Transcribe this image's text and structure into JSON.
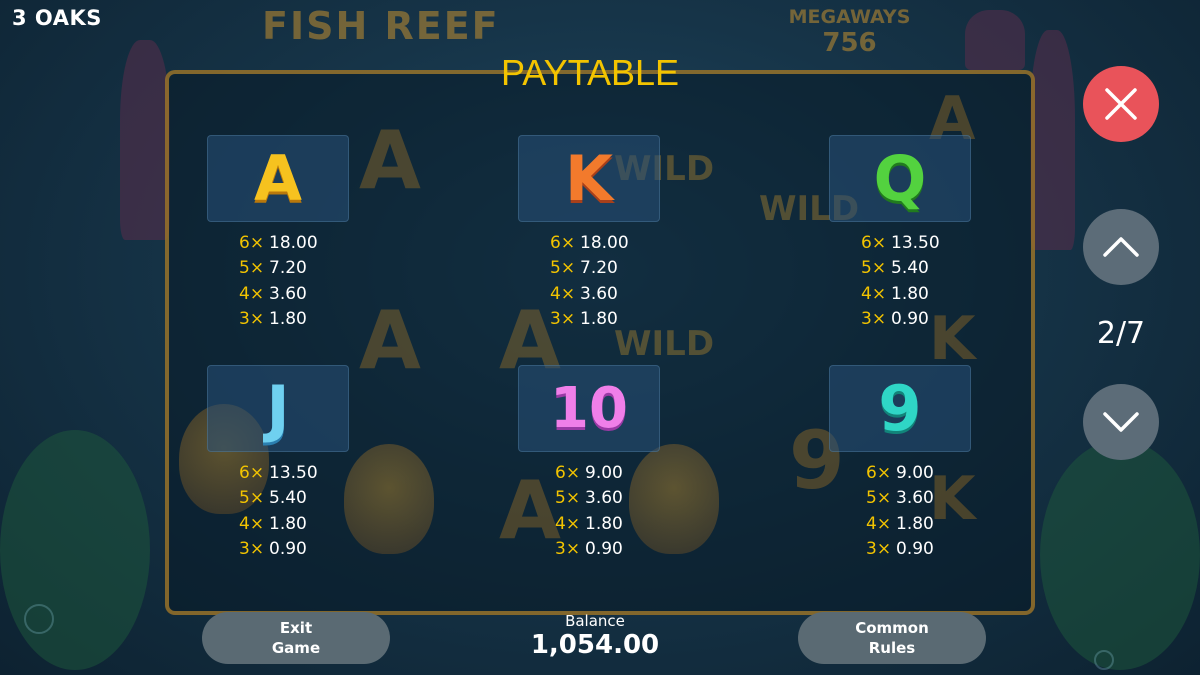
{
  "brand": "3 OAKS",
  "game_logo": "FISH REEF",
  "megaways": {
    "label": "MEGAWAYS",
    "value": "756"
  },
  "title": "PAYTABLE",
  "symbols": [
    {
      "symbol": "A",
      "pays": [
        {
          "count": "6×",
          "value": "18.00"
        },
        {
          "count": "5×",
          "value": "7.20"
        },
        {
          "count": "4×",
          "value": "3.60"
        },
        {
          "count": "3×",
          "value": "1.80"
        }
      ]
    },
    {
      "symbol": "K",
      "pays": [
        {
          "count": "6×",
          "value": "18.00"
        },
        {
          "count": "5×",
          "value": "7.20"
        },
        {
          "count": "4×",
          "value": "3.60"
        },
        {
          "count": "3×",
          "value": "1.80"
        }
      ]
    },
    {
      "symbol": "Q",
      "pays": [
        {
          "count": "6×",
          "value": "13.50"
        },
        {
          "count": "5×",
          "value": "5.40"
        },
        {
          "count": "4×",
          "value": "1.80"
        },
        {
          "count": "3×",
          "value": "0.90"
        }
      ]
    },
    {
      "symbol": "J",
      "pays": [
        {
          "count": "6×",
          "value": "13.50"
        },
        {
          "count": "5×",
          "value": "5.40"
        },
        {
          "count": "4×",
          "value": "1.80"
        },
        {
          "count": "3×",
          "value": "0.90"
        }
      ]
    },
    {
      "symbol": "10",
      "pays": [
        {
          "count": "6×",
          "value": "9.00"
        },
        {
          "count": "5×",
          "value": "3.60"
        },
        {
          "count": "4×",
          "value": "1.80"
        },
        {
          "count": "3×",
          "value": "0.90"
        }
      ]
    },
    {
      "symbol": "9",
      "pays": [
        {
          "count": "6×",
          "value": "9.00"
        },
        {
          "count": "5×",
          "value": "3.60"
        },
        {
          "count": "4×",
          "value": "1.80"
        },
        {
          "count": "3×",
          "value": "0.90"
        }
      ]
    }
  ],
  "pagination": {
    "indicator": "2/7"
  },
  "buttons": {
    "exit": {
      "line1": "Exit",
      "line2": "Game"
    },
    "rules": {
      "line1": "Common",
      "line2": "Rules"
    }
  },
  "balance": {
    "label": "Balance",
    "amount": "1,054.00"
  },
  "icons": {
    "close": "close-icon",
    "up": "chevron-up-icon",
    "down": "chevron-down-icon"
  },
  "colors": {
    "accent": "#f3c400",
    "close_button": "#e9535a",
    "nav_button": "#5c6c78"
  }
}
